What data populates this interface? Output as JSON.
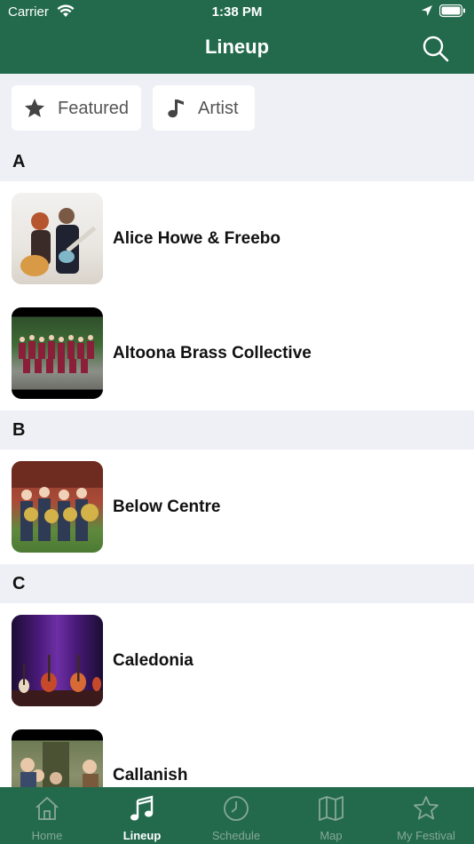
{
  "status_bar": {
    "carrier": "Carrier",
    "time": "1:38 PM"
  },
  "header": {
    "title": "Lineup",
    "search_icon": "search-icon"
  },
  "filters": [
    {
      "label": "Featured",
      "icon": "star-icon"
    },
    {
      "label": "Artist",
      "icon": "music-note-icon"
    }
  ],
  "sections": [
    {
      "letter": "A",
      "items": [
        "Alice Howe & Freebo",
        "Altoona Brass Collective"
      ]
    },
    {
      "letter": "B",
      "items": [
        "Below Centre"
      ]
    },
    {
      "letter": "C",
      "items": [
        "Caledonia",
        "Callanish"
      ]
    }
  ],
  "tabs": [
    {
      "label": "Home",
      "icon": "home-icon",
      "active": false
    },
    {
      "label": "Lineup",
      "icon": "music-notes-icon",
      "active": true
    },
    {
      "label": "Schedule",
      "icon": "clock-icon",
      "active": false
    },
    {
      "label": "Map",
      "icon": "map-icon",
      "active": false
    },
    {
      "label": "My Festival",
      "icon": "star-outline-icon",
      "active": false
    }
  ],
  "colors": {
    "brand_green": "#236a4c",
    "section_background": "#eff0f5",
    "tab_inactive": "#86a897",
    "tab_active": "#ffffff"
  }
}
